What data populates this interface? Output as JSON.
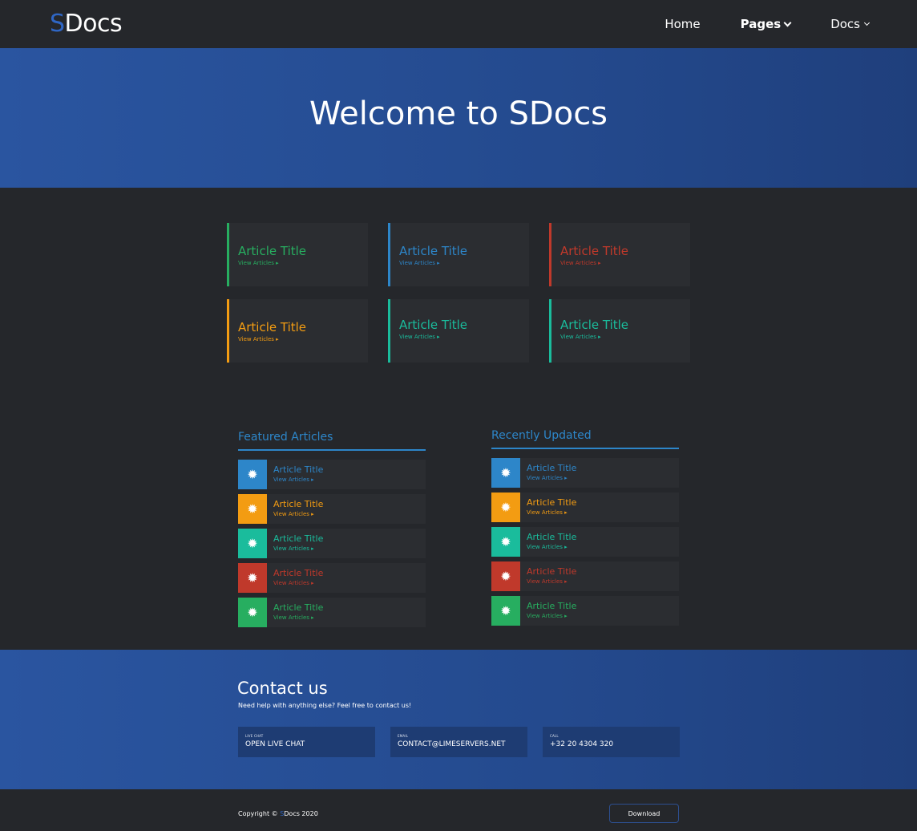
{
  "nav": {
    "logo_s": "S",
    "logo_rest": "Docs",
    "links": [
      {
        "label": "Home"
      },
      {
        "label": "Pages"
      },
      {
        "label": "Docs"
      }
    ]
  },
  "hero": {
    "title": "Welcome to SDocs"
  },
  "categories": [
    {
      "title": "Article Title",
      "link": "View Articles ▸",
      "color": "#27ae60"
    },
    {
      "title": "Article Title",
      "link": "View Articles ▸",
      "color": "#2d86c9"
    },
    {
      "title": "Article Title",
      "link": "View Articles ▸",
      "color": "#c0392b"
    },
    {
      "title": "Article Title",
      "link": "View Articles ▸",
      "color": "#f39c12"
    },
    {
      "title": "Article Title",
      "link": "View Articles ▸",
      "color": "#1abc9c"
    },
    {
      "title": "Article Title",
      "link": "View Articles ▸",
      "color": "#1abc9c"
    }
  ],
  "featured": {
    "title": "Featured Articles",
    "items": [
      {
        "title": "Article Title",
        "link": "View Articles ▸",
        "color": "#2d86c9",
        "icon": "gear-icon"
      },
      {
        "title": "Article Title",
        "link": "View Articles ▸",
        "color": "#f39c12",
        "icon": "gear-icon"
      },
      {
        "title": "Article Title",
        "link": "View Articles ▸",
        "color": "#1abc9c",
        "icon": "gear-icon"
      },
      {
        "title": "Article Title",
        "link": "View Articles ▸",
        "color": "#c0392b",
        "icon": "gear-icon"
      },
      {
        "title": "Article Title",
        "link": "View Articles ▸",
        "color": "#27ae60",
        "icon": "gear-icon"
      }
    ]
  },
  "recent": {
    "title": "Recently Updated",
    "items": [
      {
        "title": "Article Title",
        "link": "View Articles ▸",
        "color": "#2d86c9",
        "icon": "gear-icon"
      },
      {
        "title": "Article Title",
        "link": "View Articles ▸",
        "color": "#f39c12",
        "icon": "gear-icon"
      },
      {
        "title": "Article Title",
        "link": "View Articles ▸",
        "color": "#1abc9c",
        "icon": "gear-icon"
      },
      {
        "title": "Article Title",
        "link": "View Articles ▸",
        "color": "#c0392b",
        "icon": "gear-icon"
      },
      {
        "title": "Article Title",
        "link": "View Articles ▸",
        "color": "#27ae60",
        "icon": "gear-icon"
      }
    ]
  },
  "contact": {
    "title": "Contact us",
    "subtitle": "Need help with anything else? Feel free to contact us!",
    "boxes": [
      {
        "label": "LIVE CHAT",
        "value": "OPEN LIVE CHAT"
      },
      {
        "label": "EMAIL",
        "value": "CONTACT@LIMESERVERS.NET"
      },
      {
        "label": "CALL",
        "value": "+32 20 4304 320"
      }
    ]
  },
  "footer": {
    "copyright_prefix": "Copyright © ",
    "copyright_s": "S",
    "copyright_rest": "Docs 2020",
    "download_label": "Download"
  },
  "colors": {
    "accent": "#2f66c4",
    "hero_bg": "#2a55a0",
    "page_bg": "#25272b",
    "card_bg": "#2b2d31"
  }
}
